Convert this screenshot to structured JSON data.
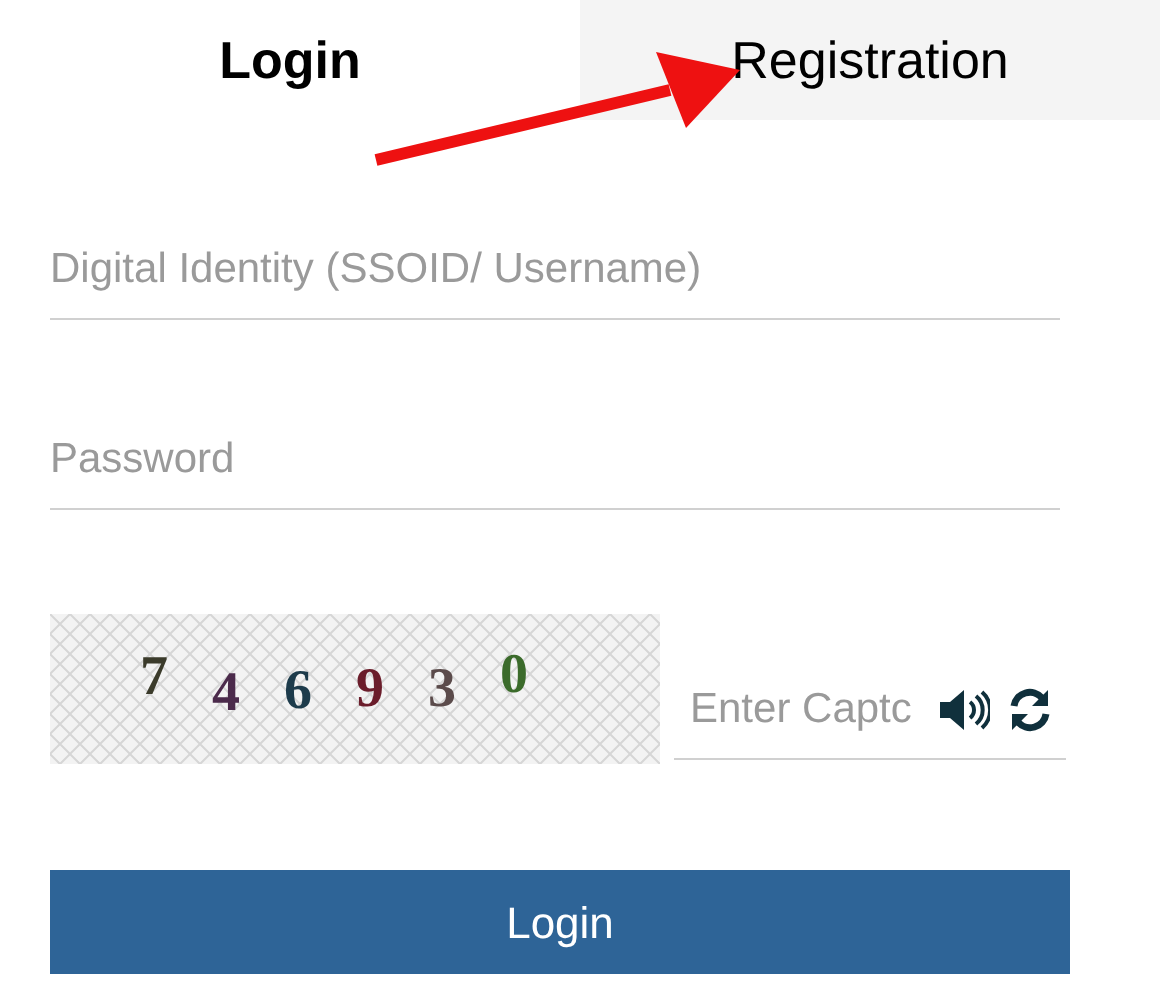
{
  "tabs": [
    {
      "label": "Login",
      "selected": true
    },
    {
      "label": "Registration",
      "selected": false
    }
  ],
  "fields": [
    {
      "placeholder": "Digital Identity (SSOID/ Username)"
    },
    {
      "placeholder": "Password"
    }
  ],
  "captcha": {
    "digits": [
      {
        "text": "7",
        "color": "#3b3b2b"
      },
      {
        "text": "4",
        "color": "#4b2a4b"
      },
      {
        "text": "6",
        "color": "#1d3b4b"
      },
      {
        "text": "9",
        "color": "#6b1d2b"
      },
      {
        "text": "3",
        "color": "#5b4b4b"
      },
      {
        "text": "0",
        "color": "#3b6b2b"
      }
    ],
    "placeholder": "Enter Captc"
  },
  "submit": {
    "label": "Login"
  }
}
